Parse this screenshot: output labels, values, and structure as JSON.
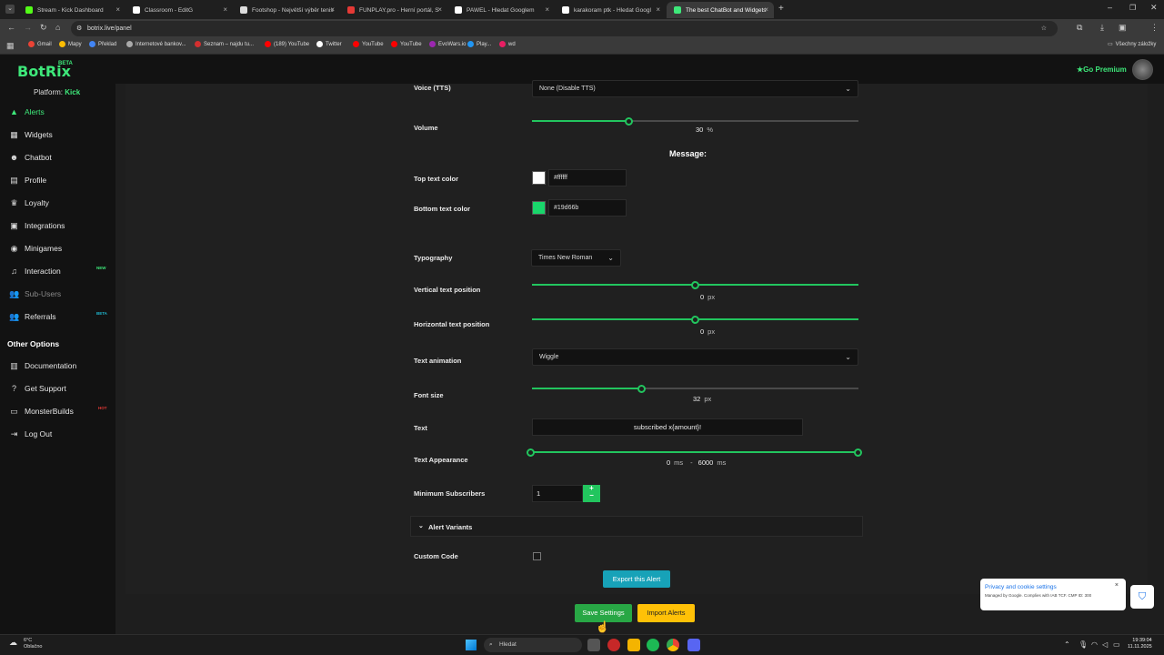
{
  "browser": {
    "tabs": [
      {
        "title": "Stream - Kick Dashboard",
        "color": "#53fc18"
      },
      {
        "title": "Classroom - EditG",
        "color": "#ffffff"
      },
      {
        "title": "Footshop - Největší výběr tenis",
        "color": "#ffffff"
      },
      {
        "title": "FUNPLAY.pro - Herní portál, S",
        "color": "#e53935"
      },
      {
        "title": "PAWEL - Hledat Googlem",
        "color": "#ffffff"
      },
      {
        "title": "karakoram ptk - Hledat Googl",
        "color": "#ffffff"
      },
      {
        "title": "The best ChatBot and Widgets",
        "color": "#3ee87a"
      }
    ],
    "url": "botrix.live/panel",
    "bookmarks": [
      "Gmail",
      "Mapy",
      "Překlad",
      "Internetové bankov...",
      "Seznam – najdu tu...",
      "(189) YouTube",
      "Twitter",
      "YouTube",
      "YouTube",
      "EvoWars.io",
      "Play...",
      "wd"
    ],
    "all_bookmarks": "Všechny záložky"
  },
  "app": {
    "logo": "BotRix",
    "logo_badge": "BETA",
    "go_premium": "Go Premium",
    "platform_label": "Platform:",
    "platform_value": "Kick"
  },
  "sidebar": {
    "items": [
      {
        "label": "Alerts",
        "icon": "warning-icon"
      },
      {
        "label": "Widgets",
        "icon": "grid-icon"
      },
      {
        "label": "Chatbot",
        "icon": "robot-icon"
      },
      {
        "label": "Profile",
        "icon": "id-card-icon"
      },
      {
        "label": "Loyalty",
        "icon": "trophy-icon"
      },
      {
        "label": "Integrations",
        "icon": "plug-icon"
      },
      {
        "label": "Minigames",
        "icon": "gamepad-icon"
      },
      {
        "label": "Interaction",
        "icon": "music-icon"
      },
      {
        "label": "Sub-Users",
        "icon": "users-icon"
      },
      {
        "label": "Referrals",
        "icon": "user-group-icon"
      }
    ],
    "badges": {
      "new": "NEW",
      "beta": "BETA",
      "hot": "HOT"
    },
    "other_title": "Other Options",
    "other_items": [
      {
        "label": "Documentation",
        "icon": "book-icon"
      },
      {
        "label": "Get Support",
        "icon": "question-icon"
      },
      {
        "label": "MonsterBuilds",
        "icon": "laptop-icon"
      },
      {
        "label": "Log Out",
        "icon": "logout-icon"
      }
    ]
  },
  "form": {
    "voice_label": "Voice (TTS)",
    "voice_value": "None (Disable TTS)",
    "volume_label": "Volume",
    "volume_value": "30",
    "volume_unit": "%",
    "volume_fraction": 0.3,
    "message_heading": "Message:",
    "top_color_label": "Top text color",
    "top_color": "#ffffff",
    "bottom_color_label": "Bottom text color",
    "bottom_color": "#19d66b",
    "typography_label": "Typography",
    "typography_value": "Times New Roman",
    "vpos_label": "Vertical text position",
    "vpos_value": "0",
    "hpos_label": "Horizontal text position",
    "hpos_value": "0",
    "px": "px",
    "anim_label": "Text animation",
    "anim_value": "Wiggle",
    "fontsize_label": "Font size",
    "fontsize_value": "32",
    "text_label": "Text",
    "text_value": "subscribed x{amount}!",
    "appearance_label": "Text Appearance",
    "appearance_from": "0",
    "appearance_to": "6000",
    "ms": "ms",
    "dash": "-",
    "minsub_label": "Minimum Subscribers",
    "minsub_value": "1",
    "variants_label": "Alert Variants",
    "custom_code_label": "Custom Code",
    "export_btn": "Export this Alert",
    "save_btn": "Save Settings",
    "import_btn": "Import Alerts"
  },
  "cookie": {
    "title": "Privacy and cookie settings",
    "desc": "Managed by Google. Complies with IAB TCF. CMP ID: 300"
  },
  "taskbar": {
    "weather_temp": "6°C",
    "weather_desc": "Oblačno",
    "search": "Hledat",
    "time": "19:39:04",
    "date": "11.11.2025"
  }
}
